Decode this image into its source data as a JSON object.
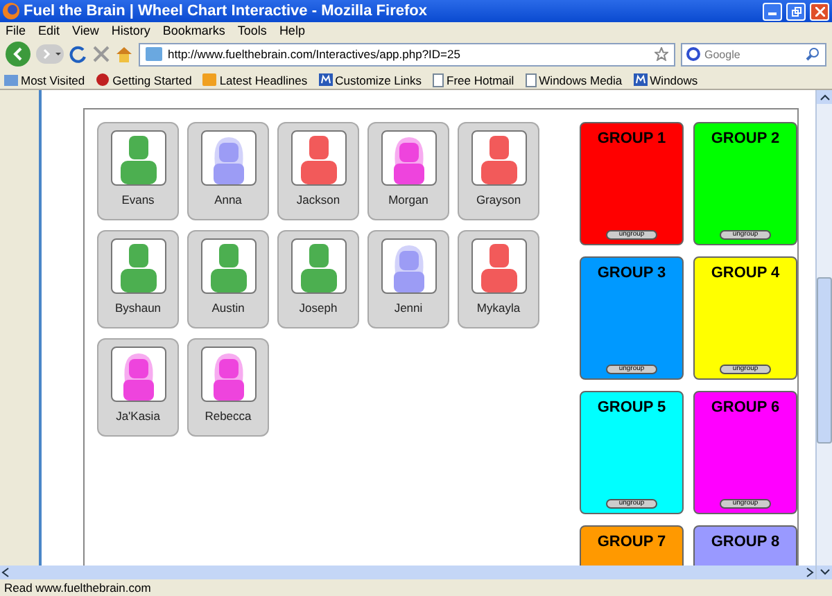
{
  "window": {
    "title": "Fuel the Brain | Wheel Chart Interactive - Mozilla Firefox"
  },
  "menu": [
    "File",
    "Edit",
    "View",
    "History",
    "Bookmarks",
    "Tools",
    "Help"
  ],
  "address_bar": {
    "url": "http://www.fuelthebrain.com/Interactives/app.php?ID=25"
  },
  "search": {
    "placeholder": "Google"
  },
  "bookmarks": [
    {
      "label": "Most Visited",
      "kind": "folder"
    },
    {
      "label": "Getting Started",
      "kind": "bird"
    },
    {
      "label": "Latest Headlines",
      "kind": "feed"
    },
    {
      "label": "Customize Links",
      "kind": "m"
    },
    {
      "label": "Free Hotmail",
      "kind": "page"
    },
    {
      "label": "Windows Media",
      "kind": "page"
    },
    {
      "label": "Windows",
      "kind": "m"
    }
  ],
  "students": [
    {
      "name": "Evans",
      "kind": "boy",
      "color": "#4caf50"
    },
    {
      "name": "Anna",
      "kind": "girl",
      "color": "#9c9cf5"
    },
    {
      "name": "Jackson",
      "kind": "boy",
      "color": "#f25a5a"
    },
    {
      "name": "Morgan",
      "kind": "girl",
      "color": "#ee44dd"
    },
    {
      "name": "Grayson",
      "kind": "boy",
      "color": "#f25a5a"
    },
    {
      "name": "Byshaun",
      "kind": "boy",
      "color": "#4caf50"
    },
    {
      "name": "Austin",
      "kind": "boy",
      "color": "#4caf50"
    },
    {
      "name": "Joseph",
      "kind": "boy",
      "color": "#4caf50"
    },
    {
      "name": "Jenni",
      "kind": "girl",
      "color": "#9c9cf5"
    },
    {
      "name": "Mykayla",
      "kind": "boy",
      "color": "#f25a5a"
    },
    {
      "name": "Ja'Kasia",
      "kind": "girl",
      "color": "#ee44dd"
    },
    {
      "name": "Rebecca",
      "kind": "girl",
      "color": "#ee44dd"
    }
  ],
  "groups": [
    {
      "label": "GROUP 1",
      "color": "#ff0000",
      "button": "ungroup"
    },
    {
      "label": "GROUP 2",
      "color": "#00ff00",
      "button": "ungroup"
    },
    {
      "label": "GROUP 3",
      "color": "#0099ff",
      "button": "ungroup"
    },
    {
      "label": "GROUP 4",
      "color": "#ffff00",
      "button": "ungroup"
    },
    {
      "label": "GROUP 5",
      "color": "#00ffff",
      "button": "ungroup"
    },
    {
      "label": "GROUP 6",
      "color": "#ff00ff",
      "button": "ungroup"
    },
    {
      "label": "GROUP 7",
      "color": "#ff9900"
    },
    {
      "label": "GROUP 8",
      "color": "#9999ff"
    }
  ],
  "status_bar": "Read www.fuelthebrain.com"
}
